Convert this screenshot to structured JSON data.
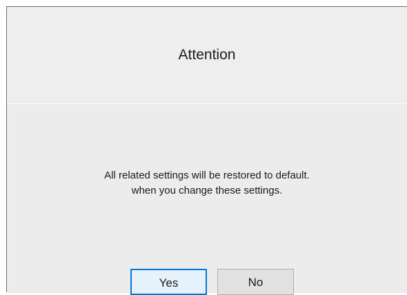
{
  "dialog": {
    "title": "Attention",
    "message_lines": [
      "All related settings will be restored to default.",
      "when you change these settings."
    ],
    "buttons": {
      "yes_label": "Yes",
      "no_label": "No"
    }
  },
  "colors": {
    "dialog_background": "#ececec",
    "default_button_border": "#0078d7",
    "default_button_fill": "#e5f1fb",
    "button_fill": "#e1e1e1",
    "text": "#1a1a1a"
  }
}
